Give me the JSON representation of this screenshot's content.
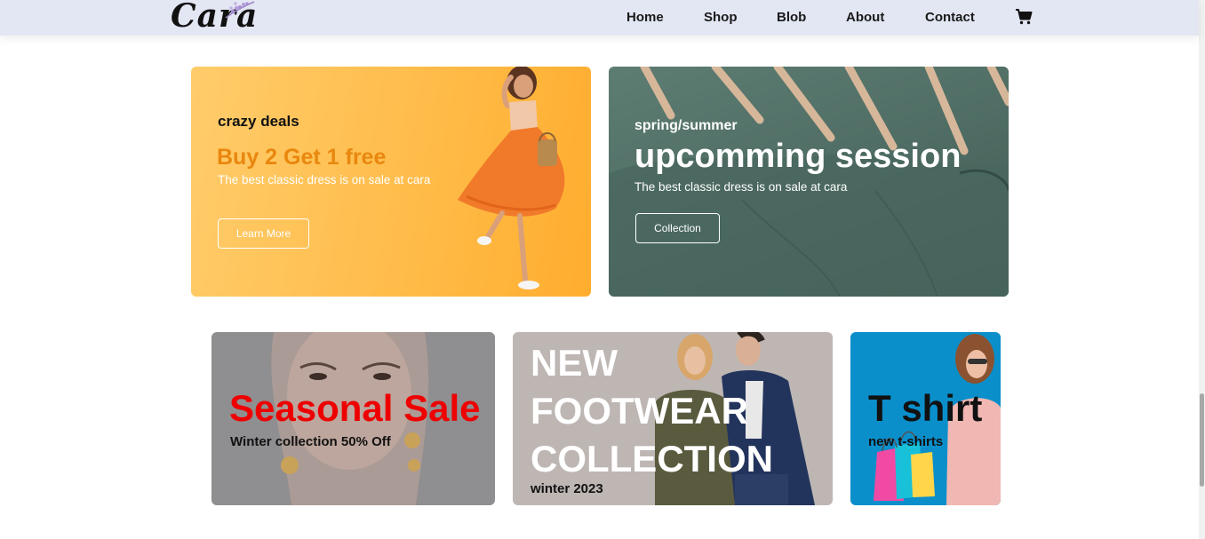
{
  "header": {
    "logo_text": "Cara",
    "nav": [
      "Home",
      "Shop",
      "Blob",
      "About",
      "Contact"
    ]
  },
  "banners": {
    "left": {
      "kicker": "crazy deals",
      "headline": "Buy 2 Get 1 free",
      "subtext": "The best classic dress is on sale at cara",
      "button": "Learn More"
    },
    "right": {
      "kicker": "spring/summer",
      "headline": "upcomming session",
      "subtext": "The best classic dress is on sale at cara",
      "button": "Collection"
    }
  },
  "small_banners": [
    {
      "title": "Seasonal Sale",
      "subtitle": "Winter collection 50% Off"
    },
    {
      "title_lines": [
        "NEW",
        "FOOTWEAR",
        "COLLECTION"
      ],
      "subtitle": "winter 2023"
    },
    {
      "title": "T shirt",
      "subtitle": "new t-shirts"
    }
  ],
  "colors": {
    "header_bg": "#e3e6f3",
    "accent_orange": "#e9870e",
    "seasonal_red": "#ee0000"
  }
}
